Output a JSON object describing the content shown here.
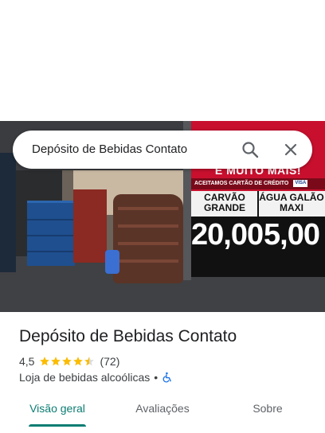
{
  "search": {
    "query": "Depósito de Bebidas Contato",
    "icons": {
      "search": "search-icon",
      "close": "close-icon"
    }
  },
  "photo": {
    "sign": {
      "headline": "E MUITO MAIS!",
      "card_notice": "ACEITAMOS CARTÃO DE CRÉDITO",
      "card_badge": "VISA",
      "products": [
        {
          "name": "CARVÃO GRANDE",
          "price": "20,00"
        },
        {
          "name": "ÁGUA GALÃO MAXI",
          "price": "5,00"
        }
      ]
    }
  },
  "place": {
    "title": "Depósito de Bebidas Contato",
    "rating": "4,5",
    "rating_value": 4.5,
    "rating_max": 5,
    "review_count": "(72)",
    "category": "Loja de bebidas alcoólicas",
    "separator": "•",
    "accessibility_icon": "wheelchair-icon"
  },
  "tabs": [
    {
      "label": "Visão geral",
      "active": true
    },
    {
      "label": "Avaliações",
      "active": false
    },
    {
      "label": "Sobre",
      "active": false
    }
  ],
  "colors": {
    "accent": "#0b7d73",
    "star": "#fbbc04",
    "sign_red": "#c8102e",
    "wheelchair": "#1a73e8"
  }
}
